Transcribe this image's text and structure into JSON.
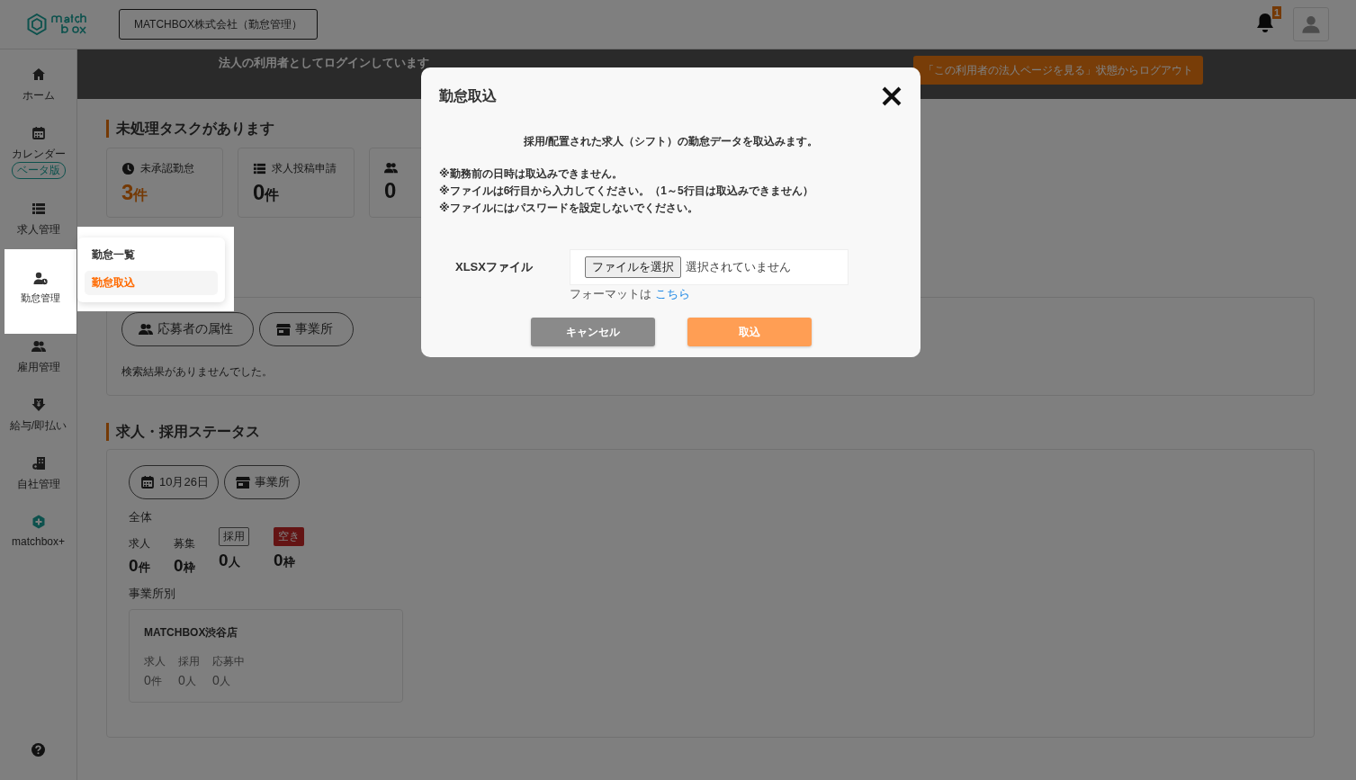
{
  "header": {
    "company": "MATCHBOX株式会社（勤怠管理）",
    "notification_count": "1"
  },
  "sidebar": {
    "items": [
      {
        "label": "ホーム",
        "selected": false
      },
      {
        "label": "カレンダー",
        "badge": "ベータ版",
        "selected": false
      },
      {
        "label": "求人管理",
        "selected": false
      },
      {
        "label": "勤怠管理",
        "selected": true
      },
      {
        "label": "雇用管理",
        "selected": false
      },
      {
        "label": "給与/即払い",
        "selected": false
      },
      {
        "label": "自社管理",
        "selected": false
      },
      {
        "label": "matchbox+",
        "selected": false
      }
    ]
  },
  "submenu": {
    "items": [
      {
        "label": "勤怠一覧",
        "selected": false
      },
      {
        "label": "勤怠取込",
        "selected": true
      }
    ]
  },
  "banner": {
    "message": "法人の利用者としてログインしています",
    "button": "「この利用者の法人ページを見る」状態からログアウト"
  },
  "tasks": {
    "title": "未処理タスクがあります",
    "cards": [
      {
        "label": "未承認勤怠",
        "count": "3",
        "unit": "件",
        "urgent": true
      },
      {
        "label": "求人投稿申請",
        "count": "0",
        "unit": "件",
        "urgent": false
      },
      {
        "count": "0",
        "urgent": false
      }
    ]
  },
  "search": {
    "filters": [
      {
        "label": "応募者の属性"
      },
      {
        "label": "事業所"
      }
    ],
    "empty": "検索結果がありませんでした。"
  },
  "status": {
    "title": "求人・採用ステータス",
    "filters": [
      {
        "label": "10月26日"
      },
      {
        "label": "事業所"
      }
    ],
    "overall_label": "全体",
    "metrics": [
      {
        "label": "求人",
        "value": "0",
        "unit": "件",
        "kind": "plain"
      },
      {
        "label": "募集",
        "value": "0",
        "unit": "枠",
        "kind": "plain"
      },
      {
        "label": "採用",
        "value": "0",
        "unit": "人",
        "kind": "outlined"
      },
      {
        "label": "空き",
        "value": "0",
        "unit": "枠",
        "kind": "alert"
      }
    ],
    "by_office_label": "事業所別",
    "offices": [
      {
        "name": "MATCHBOX渋谷店",
        "stats": [
          {
            "label": "求人",
            "value": "0",
            "unit": "件"
          },
          {
            "label": "採用",
            "value": "0",
            "unit": "人"
          },
          {
            "label": "応募中",
            "value": "0",
            "unit": "人"
          }
        ]
      }
    ]
  },
  "dialog": {
    "title": "勤怠取込",
    "intro": "採用/配置された求人（シフト）の勤怠データを取込みます。",
    "notes": [
      "※勤務前の日時は取込みできません。",
      "※ファイルは6行目から入力してください。（1～5行目は取込みできません）",
      "※ファイルにはパスワードを設定しないでください。"
    ],
    "file_label": "XLSXファイル",
    "file_button": "ファイルを選択",
    "file_status": "選択されていません",
    "format_text": "フォーマットは",
    "format_link": "こちら",
    "cancel": "キャンセル",
    "submit": "取込"
  }
}
